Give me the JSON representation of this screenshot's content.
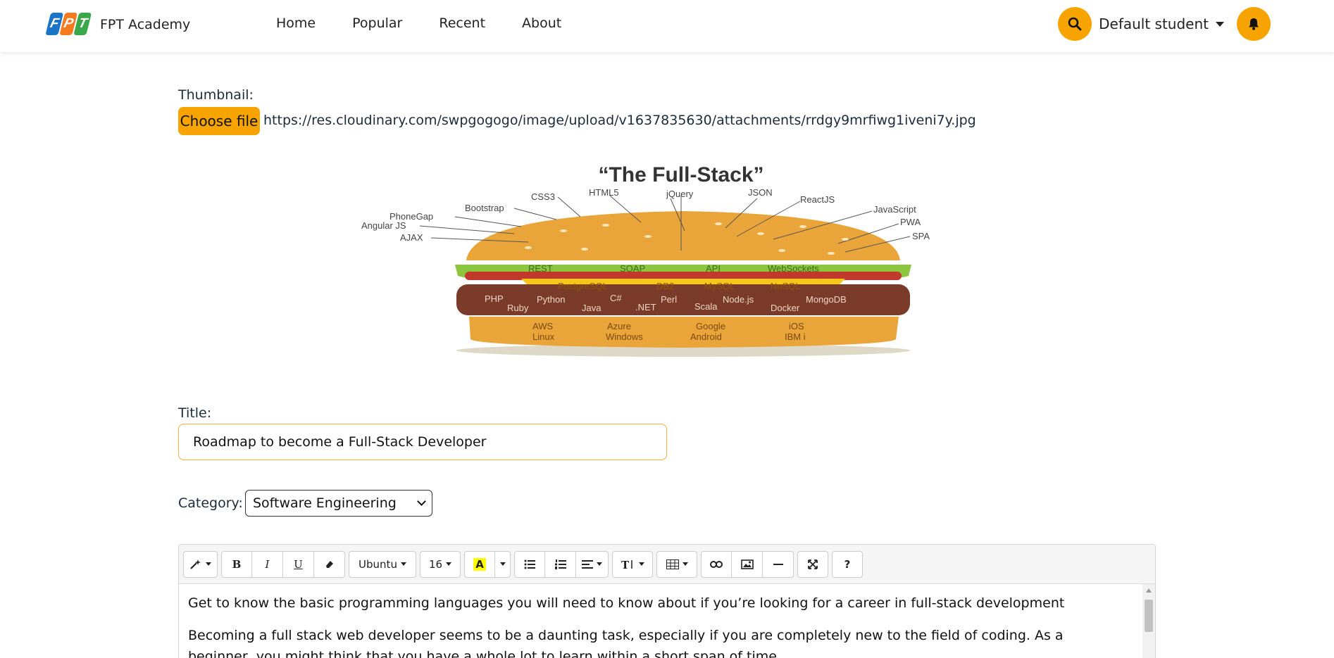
{
  "brand": {
    "logo_letters": [
      "F",
      "P",
      "T"
    ],
    "name": "FPT Academy"
  },
  "nav": {
    "links": [
      "Home",
      "Popular",
      "Recent",
      "About"
    ]
  },
  "header_right": {
    "search_icon": "search-icon",
    "user_name": "Default student",
    "bell_icon": "bell-icon"
  },
  "form": {
    "thumbnail_label": "Thumbnail:",
    "choose_file_label": "Choose file",
    "file_url": "https://res.cloudinary.com/swpgogogo/image/upload/v1637835630/attachments/rrdgy9mrfiwg1iveni7y.jpg",
    "title_label": "Title:",
    "title_value": "Roadmap to become a Full-Stack Developer",
    "category_label": "Category:",
    "category_value": "Software Engineering"
  },
  "thumbnail_image": {
    "title": "“The Full-Stack”",
    "bun_labels": [
      "CSS3",
      "HTML5",
      "jQuery",
      "JSON",
      "ReactJS",
      "JavaScript",
      "PWA",
      "SPA",
      "Bootstrap",
      "PhoneGap",
      "Angular JS",
      "AJAX"
    ],
    "lettuce_labels": [
      "REST",
      "SOAP",
      "API",
      "WebSockets"
    ],
    "cheese_labels": [
      "PostgreSQL",
      "DB2",
      "MySQL",
      "NoSQL"
    ],
    "patty_row1": [
      "PHP",
      "Python",
      "C#",
      "Perl",
      "Node.js",
      "MongoDB"
    ],
    "patty_row2": [
      "Ruby",
      "Java",
      ".NET",
      "Scala",
      "Docker"
    ],
    "bottom_row1": [
      "AWS",
      "Azure",
      "Google",
      "iOS"
    ],
    "bottom_row2": [
      "Linux",
      "Windows",
      "Android",
      "IBM i"
    ]
  },
  "editor": {
    "toolbar": {
      "font_name": "Ubuntu",
      "font_size": "16",
      "bold": "B",
      "italic": "I",
      "underline": "U",
      "help": "?"
    },
    "paragraphs": [
      "Get to know the basic programming languages you will need to know about if you’re looking for a career in full-stack development",
      "Becoming a full stack web developer seems to be a daunting task, especially if you are completely new to the field of coding. As a beginner, you might think that you have a whole lot to learn within a short span of time."
    ]
  }
}
